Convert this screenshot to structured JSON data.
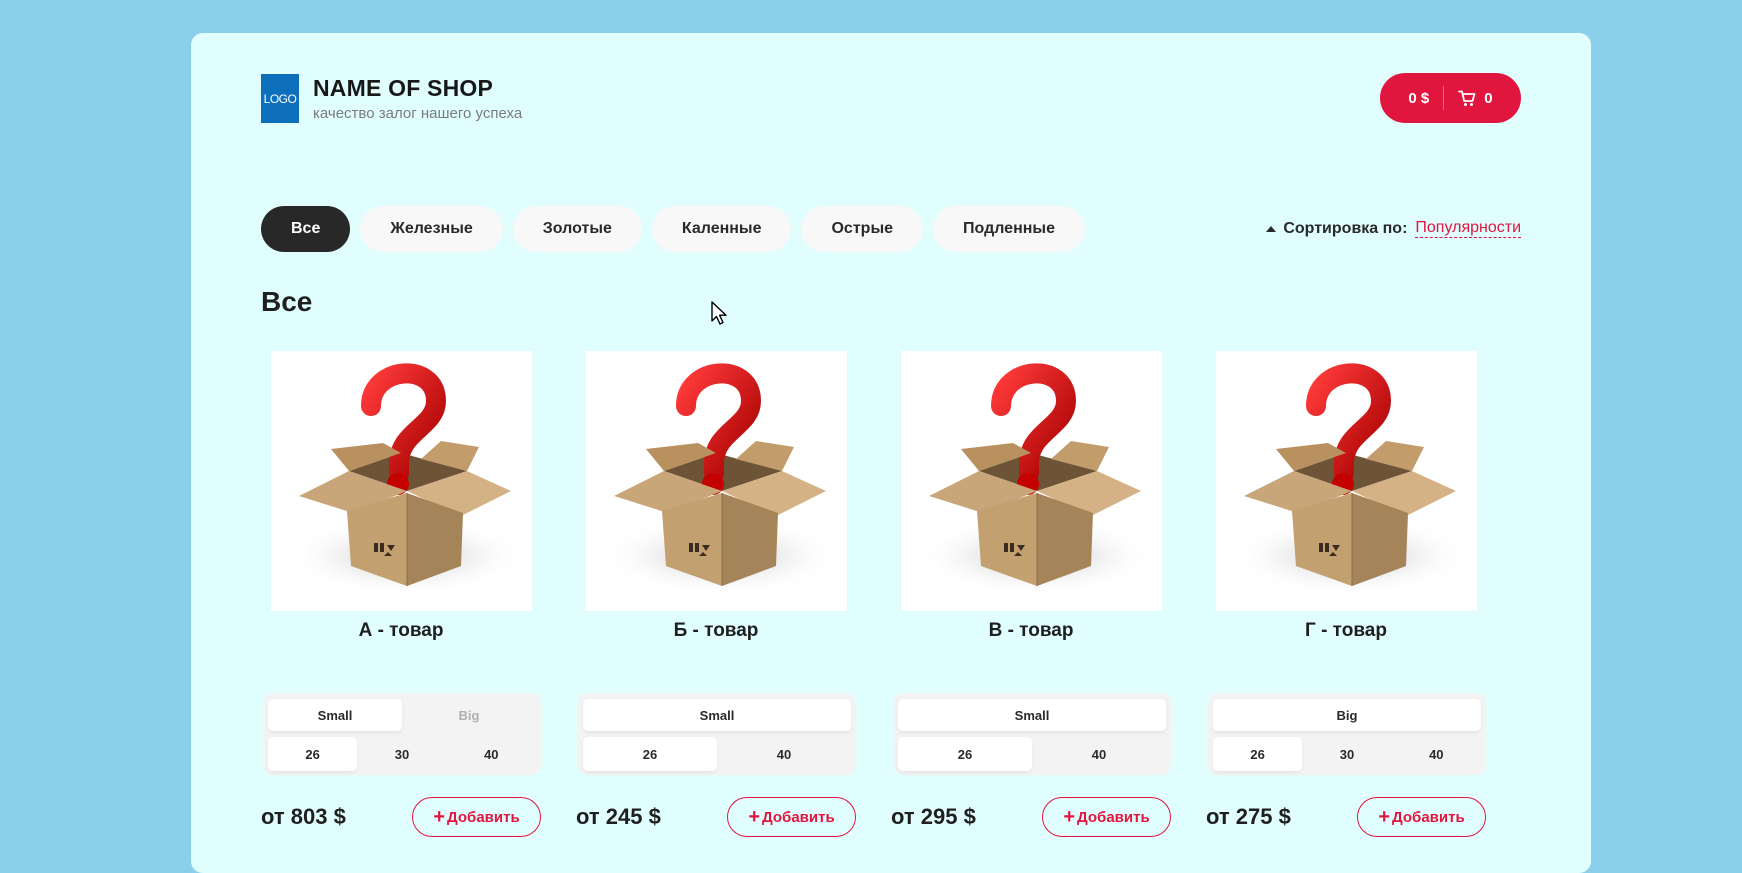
{
  "header": {
    "logo_text": "LOGO",
    "shop_name": "NAME OF SHOP",
    "tagline": "качество залог нашего успеха",
    "cart": {
      "total": "0 $",
      "count": "0"
    }
  },
  "categories": [
    "Все",
    "Железные",
    "Золотые",
    "Каленные",
    "Острые",
    "Подленные"
  ],
  "active_category": "Все",
  "sort": {
    "label": "Сортировка по:",
    "value": "Популярности"
  },
  "section_title": "Все",
  "products": [
    {
      "name": "А - товар",
      "types": [
        "Small",
        "Big"
      ],
      "types_state": [
        "selected",
        "disabled"
      ],
      "sizes": [
        "26",
        "30",
        "40"
      ],
      "size_selected": "26",
      "price": "от 803 $",
      "add_label": "Добавить"
    },
    {
      "name": "Б - товар",
      "types": [
        "Small"
      ],
      "types_state": [
        "selected"
      ],
      "sizes": [
        "26",
        "40"
      ],
      "size_selected": "26",
      "price": "от 245 $",
      "add_label": "Добавить"
    },
    {
      "name": "В - товар",
      "types": [
        "Small"
      ],
      "types_state": [
        "selected"
      ],
      "sizes": [
        "26",
        "40"
      ],
      "size_selected": "26",
      "price": "от 295 $",
      "add_label": "Добавить"
    },
    {
      "name": "Г - товар",
      "types": [
        "Big"
      ],
      "types_state": [
        "selected"
      ],
      "sizes": [
        "26",
        "30",
        "40"
      ],
      "size_selected": "26",
      "price": "от 275 $",
      "add_label": "Добавить"
    }
  ],
  "colors": {
    "accent": "#e0163f",
    "page_bg": "#8ccfea",
    "panel_bg": "#e1fefe",
    "dark": "#282828"
  },
  "icons": [
    "cart-icon",
    "sort-arrow-up-icon",
    "mystery-box-icon",
    "plus-icon",
    "mouse-cursor-icon"
  ]
}
